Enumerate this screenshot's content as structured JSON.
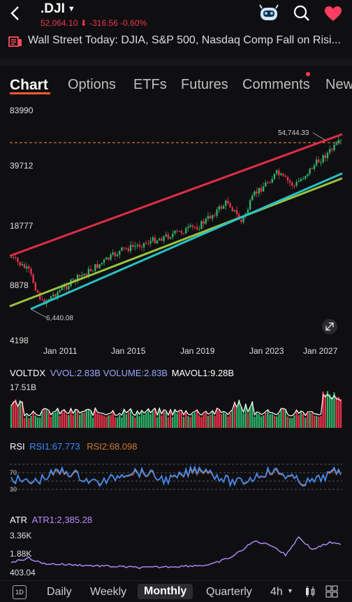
{
  "header": {
    "symbol": ".DJI",
    "price_line": "52,064.10 ⬇ -316.56 -0.60%"
  },
  "news": {
    "headline": "Wall Street Today: DJIA, S&P 500, Nasdaq Comp Fall on Risi..."
  },
  "tabs": [
    "Chart",
    "Options",
    "ETFs",
    "Futures",
    "Comments",
    "News"
  ],
  "main_chart": {
    "y_labels": [
      "83990",
      "39712",
      "18777",
      "8878",
      "4198"
    ],
    "x_labels": [
      "Jan 2011",
      "Jan 2015",
      "Jan 2019",
      "Jan 2023",
      "Jan 2027"
    ],
    "high_label": "54,744.33",
    "low_label": "6,440.08"
  },
  "volume": {
    "name": "VOLTDX",
    "vvol": "VVOL:2.83B",
    "volume": "VOLUME:2.83B",
    "mavol": "MAVOL1:9.28B",
    "max_label": "17.51B"
  },
  "rsi": {
    "name": "RSI",
    "rsi1": "RSI1:67.773",
    "rsi2": "RSI2:68.098",
    "level_high": "70",
    "level_low": "30"
  },
  "atr": {
    "name": "ATR",
    "atr1": "ATR1:2,385.28",
    "labels": [
      "3.36K",
      "1.88K",
      "403.04"
    ]
  },
  "bottom_bar": {
    "items": [
      "Daily",
      "Weekly",
      "Monthly",
      "Quarterly",
      "4h"
    ],
    "active": "Monthly"
  },
  "colors": {
    "up": "#2fb36a",
    "down": "#e8334a",
    "accent": "#ff5a2e",
    "rsi1": "#3d8bff",
    "rsi2": "#d07a2a",
    "atr": "#b78cff"
  }
}
